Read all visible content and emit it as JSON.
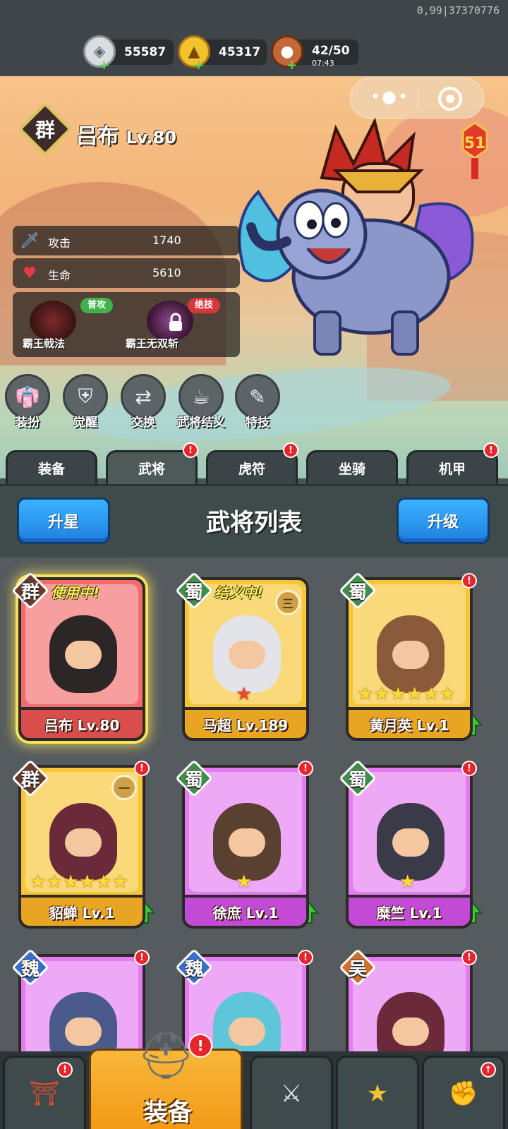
{
  "debug": "0,99|37370776",
  "resources": [
    {
      "name": "silver",
      "icon": "silver-coin-icon",
      "value": "55587"
    },
    {
      "name": "gold",
      "icon": "gold-ingot-icon",
      "value": "45317"
    },
    {
      "name": "stamina",
      "icon": "meat-icon",
      "value": "42/50",
      "timer": "07:43"
    }
  ],
  "hero": {
    "faction": "群",
    "name": "吕布",
    "level": "Lv.80",
    "stats": [
      {
        "icon": "sword-icon",
        "label": "攻击",
        "value": "1740"
      },
      {
        "icon": "heart-icon",
        "label": "生命",
        "value": "5610"
      }
    ],
    "skills": [
      {
        "tag": "普攻",
        "name": "霸王戟法",
        "locked": false
      },
      {
        "tag": "绝技",
        "name": "霸王无双斩",
        "locked": true
      }
    ]
  },
  "event_badge": "51",
  "functions": [
    {
      "label": "装扮",
      "icon": "robe-icon"
    },
    {
      "label": "觉醒",
      "icon": "armor-icon"
    },
    {
      "label": "交换",
      "icon": "swap-icon"
    },
    {
      "label": "武将结义",
      "icon": "bowl-icon"
    },
    {
      "label": "特技",
      "icon": "scroll-icon"
    }
  ],
  "tabs": [
    {
      "label": "装备",
      "dot": false
    },
    {
      "label": "武将",
      "dot": true,
      "active": true
    },
    {
      "label": "虎符",
      "dot": true
    },
    {
      "label": "坐骑",
      "dot": false
    },
    {
      "label": "机甲",
      "dot": true
    }
  ],
  "panel": {
    "title": "武将列表",
    "star_button": "升星",
    "level_button": "升级"
  },
  "cards": [
    {
      "faction": "群",
      "name": "吕布 Lv.80",
      "status": "使用中!",
      "rarity": "red",
      "stars": 0,
      "alert": false,
      "upgrade": false
    },
    {
      "faction": "蜀",
      "name": "马超 Lv.189",
      "status": "结义中!",
      "rank": "三",
      "rarity": "gold",
      "stars": 1,
      "alert": false,
      "upgrade": false
    },
    {
      "faction": "蜀",
      "name": "黄月英 Lv.1",
      "status": "",
      "rarity": "gold",
      "stars": 6,
      "alert": true,
      "upgrade": true
    },
    {
      "faction": "群",
      "name": "貂蝉 Lv.1",
      "status": "",
      "rank": "一",
      "rarity": "gold",
      "stars": 6,
      "alert": true,
      "upgrade": true
    },
    {
      "faction": "蜀",
      "name": "徐庶 Lv.1",
      "status": "",
      "rarity": "purple",
      "stars": 1,
      "alert": true,
      "upgrade": true
    },
    {
      "faction": "蜀",
      "name": "糜竺 Lv.1",
      "status": "",
      "rarity": "purple",
      "stars": 1,
      "alert": true,
      "upgrade": true
    },
    {
      "faction": "魏",
      "name": "",
      "status": "",
      "rarity": "purple",
      "stars": 0,
      "alert": true,
      "upgrade": false
    },
    {
      "faction": "魏",
      "name": "",
      "status": "",
      "rarity": "purple",
      "stars": 0,
      "alert": true,
      "upgrade": false
    },
    {
      "faction": "吴",
      "name": "",
      "status": "",
      "rarity": "purple",
      "stars": 0,
      "alert": true,
      "upgrade": false
    }
  ],
  "bottom_nav": [
    {
      "icon": "gate-icon",
      "label": "",
      "dot": true
    },
    {
      "icon": "helmet-icon",
      "label": "装备",
      "dot": true,
      "active": true
    },
    {
      "icon": "crossed-swords-icon",
      "label": "",
      "dot": false
    },
    {
      "icon": "stars-badge-icon",
      "label": "",
      "dot": false
    },
    {
      "icon": "fist-upgrade-icon",
      "label": "",
      "dot": true
    }
  ],
  "colors": {
    "faction_qun": "#6b3a2a",
    "faction_shu": "#3f8f4a",
    "faction_wei": "#3a6fd0",
    "faction_wu": "#d0702a",
    "alert": "#e8242c"
  }
}
